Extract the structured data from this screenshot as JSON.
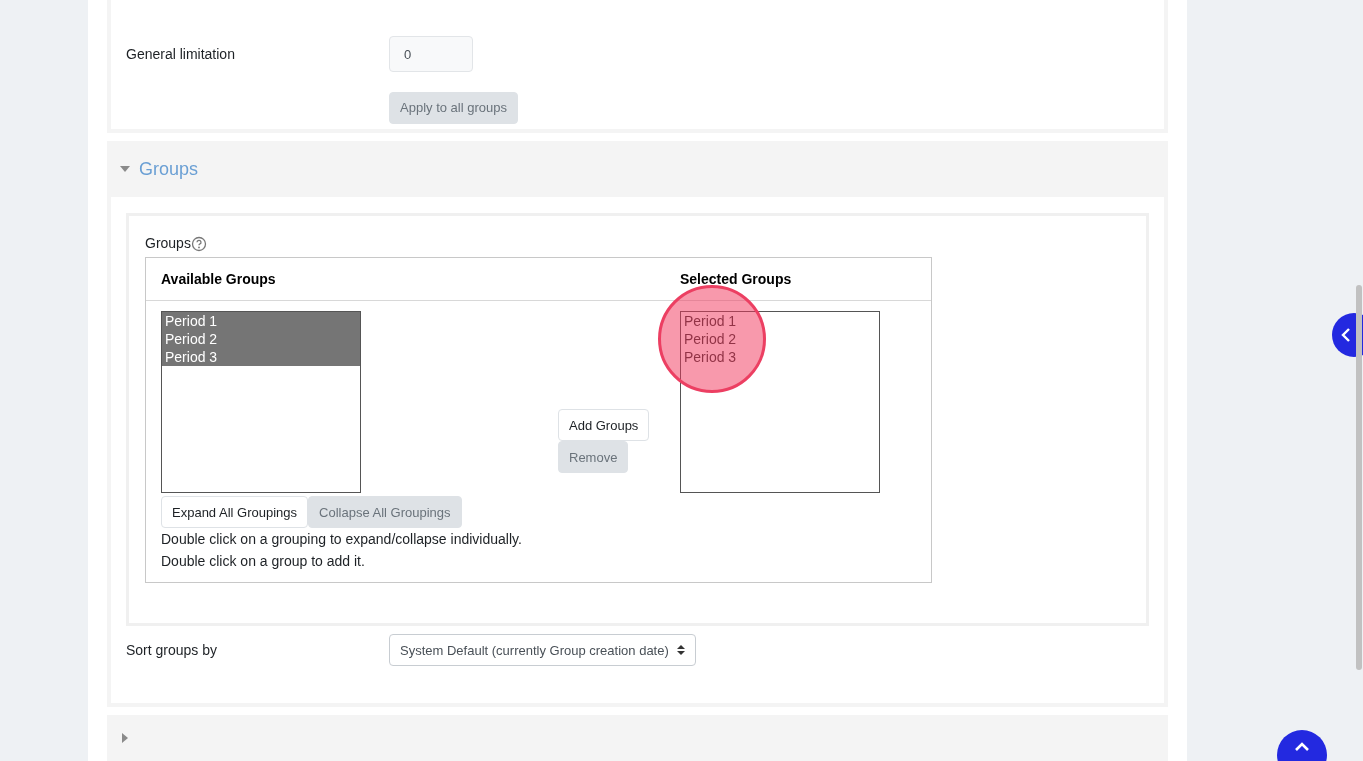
{
  "general_limitation": {
    "label": "General limitation",
    "value": "0"
  },
  "apply_button": {
    "label": "Apply to all groups",
    "disabled": true
  },
  "groups_section": {
    "title": "Groups",
    "expanded": true
  },
  "groups_field": {
    "label": "Groups",
    "available": {
      "heading": "Available Groups",
      "items": [
        {
          "label": "Period 1",
          "selected": true
        },
        {
          "label": "Period 2",
          "selected": true
        },
        {
          "label": "Period 3",
          "selected": true
        }
      ]
    },
    "selected": {
      "heading": "Selected Groups",
      "items": [
        {
          "label": "Period 1",
          "selected": false
        },
        {
          "label": "Period 2",
          "selected": false
        },
        {
          "label": "Period 3",
          "selected": false
        }
      ]
    },
    "add_button": {
      "label": "Add Groups",
      "disabled": false
    },
    "remove_button": {
      "label": "Remove",
      "disabled": true
    },
    "expand_button": {
      "label": "Expand All Groupings",
      "disabled": false
    },
    "collapse_button": {
      "label": "Collapse All Groupings",
      "disabled": true
    },
    "hints": [
      "Double click on a grouping to expand/collapse individually.",
      "Double click on a group to add it."
    ]
  },
  "sort": {
    "label": "Sort groups by",
    "value": "System Default (currently Group creation date)"
  },
  "next_section": {
    "expanded": false
  }
}
